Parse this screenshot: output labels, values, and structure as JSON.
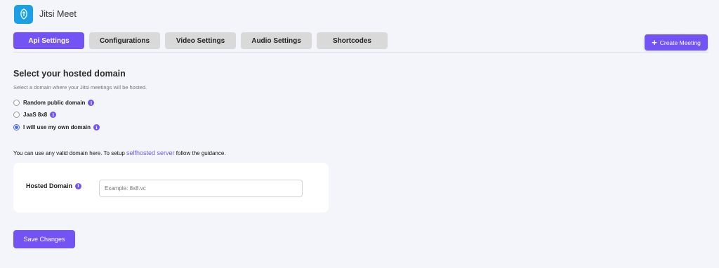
{
  "app": {
    "title": "Jitsi Meet",
    "logo_icon": "jitsi-logo-icon"
  },
  "tabs": [
    {
      "label": "Api Settings",
      "active": true
    },
    {
      "label": "Configurations",
      "active": false
    },
    {
      "label": "Video Settings",
      "active": false
    },
    {
      "label": "Audio Settings",
      "active": false
    },
    {
      "label": "Shortcodes",
      "active": false
    }
  ],
  "header": {
    "create_meeting_label": "Create Meeting",
    "create_meeting_icon": "plus-icon"
  },
  "domain_section": {
    "title": "Select your hosted domain",
    "description": "Select a domain where your Jitsi meetings will be hosted.",
    "options": [
      {
        "label": "Random public domain",
        "checked": false
      },
      {
        "label": "JaaS 8x8",
        "checked": false
      },
      {
        "label": "I will use my own domain",
        "checked": true
      }
    ]
  },
  "guidance": {
    "prefix": "You can use any valid domain here. To setup",
    "link_text": "selfhosted server",
    "suffix": "follow the guidance."
  },
  "hosted_domain": {
    "label": "Hosted Domain",
    "placeholder": "Example: 8x8.vc",
    "value": ""
  },
  "save_label": "Save Changes",
  "colors": {
    "accent": "#7453f5",
    "tab_inactive": "#d9d9d9",
    "background": "#f4f5fa",
    "radio_checked": "#4a6df0"
  }
}
